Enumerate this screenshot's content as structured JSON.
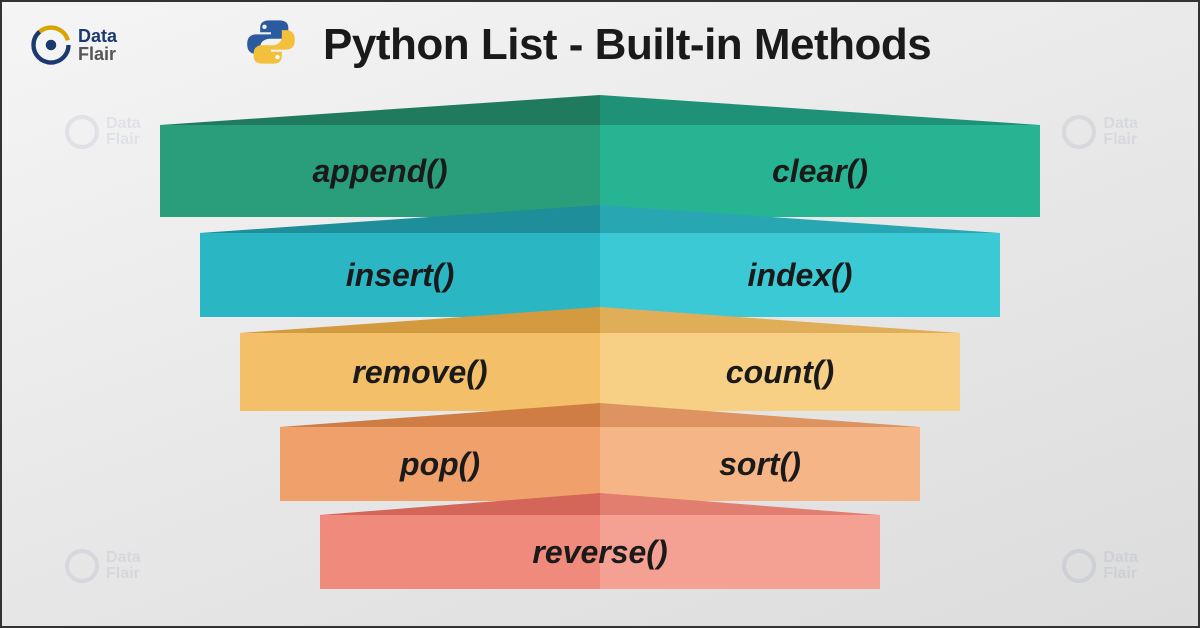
{
  "brand": {
    "line1": "Data",
    "line2": "Flair"
  },
  "title": "Python List - Built-in Methods",
  "rows": [
    {
      "left": "append()",
      "right": "clear()"
    },
    {
      "left": "insert()",
      "right": "index()"
    },
    {
      "left": "remove()",
      "right": "count()"
    },
    {
      "left": "pop()",
      "right": "sort()"
    }
  ],
  "bottom": {
    "center": "reverse()"
  },
  "colors": {
    "row0": {
      "leftFace": "#2a9d7a",
      "rightFace": "#27b493",
      "leftTop": "#1f7a5e",
      "rightTop": "#1f9176"
    },
    "row1": {
      "leftFace": "#2bb6c4",
      "rightFace": "#3cc9d6",
      "leftTop": "#1d8e9a",
      "rightTop": "#28a7b3"
    },
    "row2": {
      "leftFace": "#f3c069",
      "rightFace": "#f7cf85",
      "leftTop": "#d49a3f",
      "rightTop": "#e0ae58"
    },
    "row3": {
      "leftFace": "#f0a06a",
      "rightFace": "#f5b586",
      "leftTop": "#d07c45",
      "rightTop": "#dd9460"
    },
    "bottom": {
      "leftFace": "#ef8a7c",
      "rightFace": "#f4a193",
      "leftTop": "#d36559",
      "rightTop": "#e17e70"
    }
  }
}
